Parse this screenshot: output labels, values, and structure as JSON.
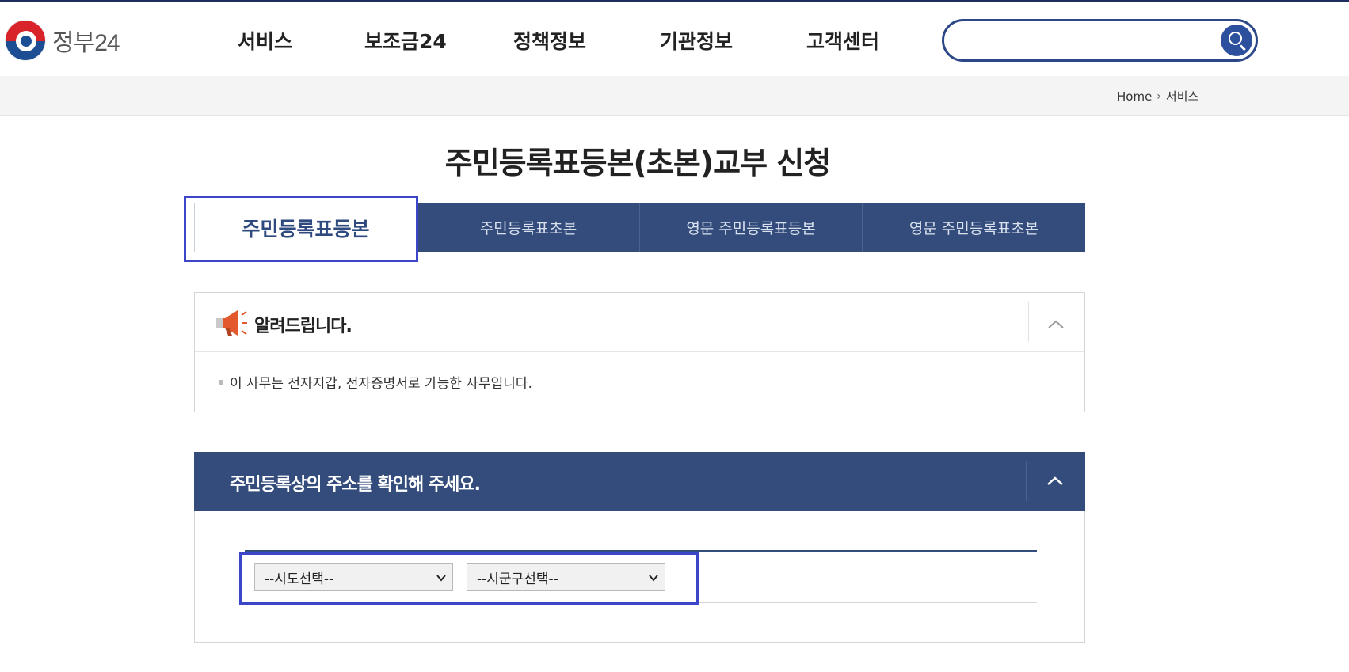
{
  "header": {
    "logo_text": "정부24",
    "nav": [
      {
        "label": "서비스"
      },
      {
        "label": "보조금24"
      },
      {
        "label": "정책정보"
      },
      {
        "label": "기관정보"
      },
      {
        "label": "고객센터"
      }
    ],
    "search": {
      "value": "",
      "placeholder": ""
    }
  },
  "breadcrumb": {
    "home": "Home",
    "current": "서비스"
  },
  "page_title": "주민등록표등본(초본)교부 신청",
  "tabs": [
    {
      "label": "주민등록표등본",
      "active": true
    },
    {
      "label": "주민등록표초본",
      "active": false
    },
    {
      "label": "영문 주민등록표등본",
      "active": false
    },
    {
      "label": "영문 주민등록표초본",
      "active": false
    }
  ],
  "notice": {
    "title": "알려드립니다.",
    "text": "이 사무는 전자지갑, 전자증명서로 가능한 사무입니다."
  },
  "address": {
    "title": "주민등록상의 주소를 확인해 주세요.",
    "sido_select": "--시도선택--",
    "sigungu_select": "--시군구선택--"
  },
  "colors": {
    "navy": "#334c7b",
    "highlight": "#3c46c9",
    "search_border": "#2c4787"
  },
  "icons": [
    "search-icon",
    "megaphone-icon",
    "chevron-up-icon",
    "chevron-down-icon",
    "chevron-right-icon"
  ]
}
